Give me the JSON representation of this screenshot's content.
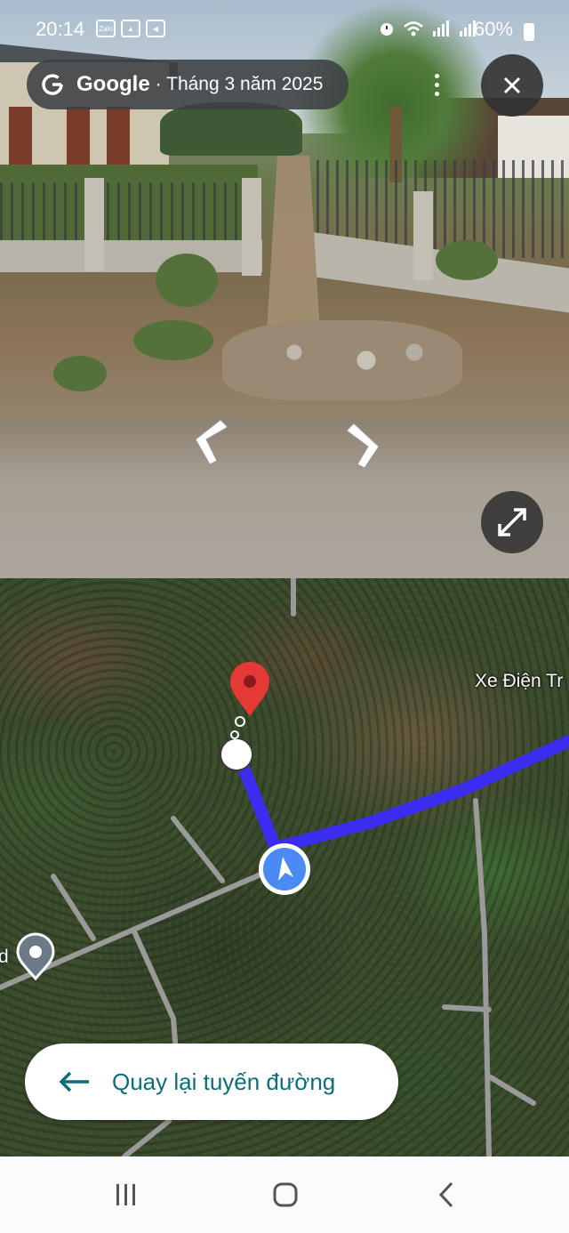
{
  "status_bar": {
    "time": "20:14",
    "battery": "60%",
    "left_icons": [
      "zalo-icon",
      "gallery-icon",
      "video-call-icon"
    ],
    "right_icons": [
      "alarm-icon",
      "wifi-icon",
      "signal-icon",
      "signal-icon"
    ]
  },
  "header": {
    "brand": "Google",
    "date": "· Tháng 3 năm 2025"
  },
  "streetview": {
    "nav_icons": [
      "chevron-left-icon",
      "chevron-right-icon"
    ],
    "expand_icon": "expand-icon"
  },
  "map": {
    "place_label": "Xe Điện Tr",
    "partial_label": "d",
    "route_color": "#3b2df0",
    "pin_color": "#e53935",
    "location_color": "#4a8af4"
  },
  "back_button": {
    "label": "Quay lại tuyến đường"
  },
  "system_nav": [
    "recents-icon",
    "home-icon",
    "back-icon"
  ]
}
